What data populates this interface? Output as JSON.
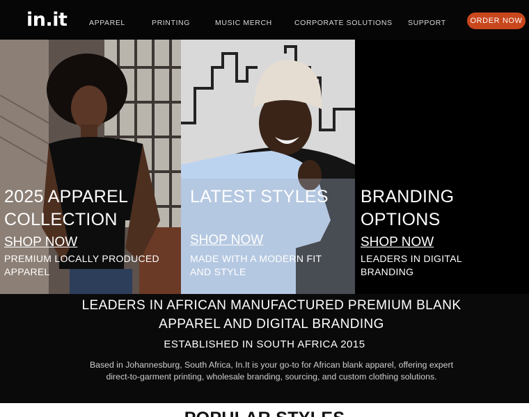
{
  "header": {
    "logo": "in.it",
    "nav": [
      {
        "label": "APPAREL"
      },
      {
        "label": "PRINTING"
      },
      {
        "label": "MUSIC MERCH"
      },
      {
        "label": "CORPORATE SOLUTIONS"
      },
      {
        "label": "SUPPORT"
      }
    ],
    "order_button": "ORDER NOW",
    "accent_color": "#c9471d"
  },
  "hero": {
    "panels": [
      {
        "title_line1": "2025 APPAREL",
        "title_line2": "COLLECTION",
        "shop": "SHOP NOW",
        "desc_line1": "PREMIUM LOCALLY PRODUCED",
        "desc_line2": "APPAREL"
      },
      {
        "title_line1": "LATEST STYLES",
        "title_line2": "",
        "shop": "SHOP NOW",
        "desc_line1": "MADE WITH A MODERN FIT",
        "desc_line2": "AND STYLE"
      },
      {
        "title_line1": "BRANDING",
        "title_line2": "OPTIONS",
        "shop": "SHOP NOW",
        "desc_line1": "LEADERS IN DIGITAL",
        "desc_line2": "BRANDING"
      }
    ]
  },
  "info": {
    "headline_line1": "LEADERS IN AFRICAN MANUFACTURED PREMIUM BLANK",
    "headline_line2": "APPAREL AND DIGITAL BRANDING",
    "subheading": "ESTABLISHED IN SOUTH AFRICA 2015",
    "body_line1": "Based in Johannesburg, South Africa, In.It is your go-to for African blank apparel, offering expert",
    "body_line2": "direct-to-garment printing, wholesale branding, sourcing, and custom clothing solutions."
  },
  "popular": {
    "title": "POPULAR STYLES"
  }
}
